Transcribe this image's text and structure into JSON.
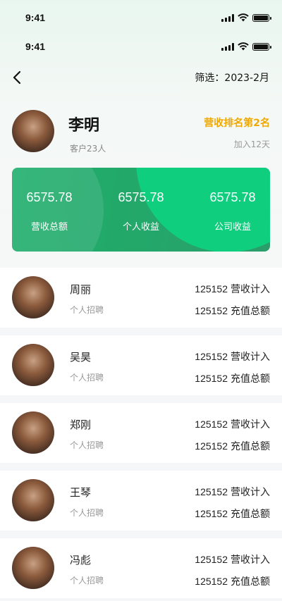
{
  "status_bar": {
    "time": "9:41"
  },
  "nav": {
    "filter_label": "筛选：2023-2月"
  },
  "profile": {
    "name": "李明",
    "clients": "客户23人",
    "rank": "营收排名第2名",
    "joined": "加入12天"
  },
  "summary": [
    {
      "value": "6575.78",
      "label": "营收总额"
    },
    {
      "value": "6575.78",
      "label": "个人收益"
    },
    {
      "value": "6575.78",
      "label": "公司收益"
    }
  ],
  "members": [
    {
      "name": "周丽",
      "tag": "个人招聘",
      "revenue_value": "125152",
      "revenue_label": "营收计入",
      "recharge_value": "125152",
      "recharge_label": "充值总额"
    },
    {
      "name": "吴昊",
      "tag": "个人招聘",
      "revenue_value": "125152",
      "revenue_label": "营收计入",
      "recharge_value": "125152",
      "recharge_label": "充值总额"
    },
    {
      "name": "郑刚",
      "tag": "个人招聘",
      "revenue_value": "125152",
      "revenue_label": "营收计入",
      "recharge_value": "125152",
      "recharge_label": "充值总额"
    },
    {
      "name": "王琴",
      "tag": "个人招聘",
      "revenue_value": "125152",
      "revenue_label": "营收计入",
      "recharge_value": "125152",
      "recharge_label": "充值总额"
    },
    {
      "name": "冯彪",
      "tag": "个人招聘",
      "revenue_value": "125152",
      "revenue_label": "营收计入",
      "recharge_value": "125152",
      "recharge_label": "充值总额"
    }
  ],
  "colors": {
    "accent": "#23a86a",
    "rank": "#f0a800"
  }
}
